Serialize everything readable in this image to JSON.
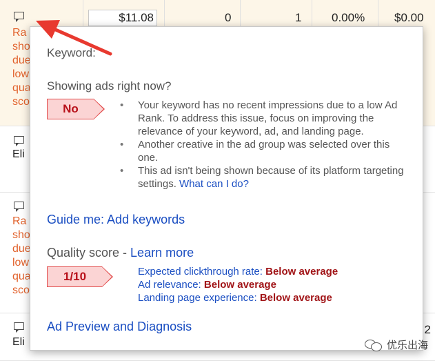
{
  "table": {
    "row1": {
      "status_lines": [
        "Ra",
        "sho",
        "due",
        "low",
        "qua",
        "sco"
      ],
      "bid": "$11.08",
      "clicks": "0",
      "impressions": "1",
      "ctr": "0.00%",
      "cost": "$0.00"
    },
    "row2": {
      "status": "Eli"
    },
    "row3": {
      "status_lines": [
        "Ra",
        "sho",
        "due",
        "low",
        "qua",
        "sco"
      ]
    },
    "row4": {
      "status": "Eli",
      "partial_value": "2"
    }
  },
  "popup": {
    "keyword_label": "Keyword:",
    "showing_heading": "Showing ads right now?",
    "showing_value": "No",
    "reasons": [
      "Your keyword has no recent impressions due to a low Ad Rank. To address this issue, focus on improving the relevance of your keyword, ad, and landing page.",
      "Another creative in the ad group was selected over this one.",
      "This ad isn't being shown because of its platform targeting settings."
    ],
    "what_can_i_do": "What can I do?",
    "guide_link": "Guide me: Add keywords",
    "quality_label": "Quality score - ",
    "learn_more": "Learn more",
    "score": "1/10",
    "metrics": [
      {
        "label": "Expected clickthrough rate: ",
        "value": "Below average"
      },
      {
        "label": "Ad relevance: ",
        "value": "Below average"
      },
      {
        "label": "Landing page experience: ",
        "value": "Below average"
      }
    ],
    "ad_preview_link": "Ad Preview and Diagnosis"
  },
  "watermark": {
    "text": "优乐出海"
  },
  "colors": {
    "link": "#1a4ec2",
    "warning_text": "#e2622c",
    "row_highlight": "#fdf6e8",
    "badge_fill": "#fbd4d4",
    "badge_border": "#e24c4c",
    "metric_value": "#a11417",
    "arrow": "#e8392f"
  }
}
